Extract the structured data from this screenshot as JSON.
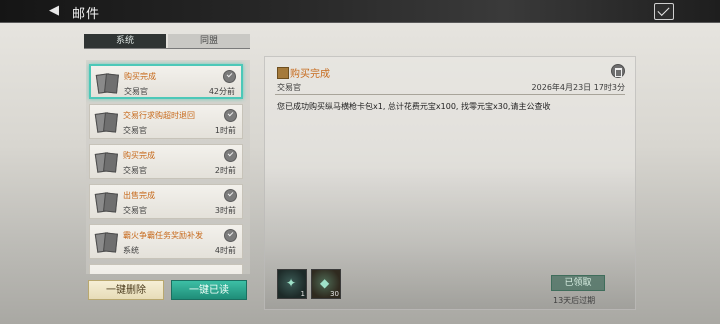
{
  "header": {
    "back_icon": "back-arrow-icon",
    "title": "邮件",
    "mail_icon": "mail-claim-icon"
  },
  "tabs": [
    {
      "label": "系统",
      "active": true
    },
    {
      "label": "同盟",
      "active": false
    }
  ],
  "mail_list": [
    {
      "subject": "购买完成",
      "sender": "交易官",
      "time": "42分前",
      "selected": true
    },
    {
      "subject": "交易行求购超时退回",
      "sender": "交易官",
      "time": "1时前",
      "selected": false
    },
    {
      "subject": "购买完成",
      "sender": "交易官",
      "time": "2时前",
      "selected": false
    },
    {
      "subject": "出售完成",
      "sender": "交易官",
      "time": "3时前",
      "selected": false
    },
    {
      "subject": "霸火争霸任务奖励补发",
      "sender": "系统",
      "time": "4时前",
      "selected": false
    }
  ],
  "actions": {
    "delete_all": "一键删除",
    "read_all": "一键已读"
  },
  "detail": {
    "subject": "购买完成",
    "sender": "交易官",
    "date": "2026年4月23日 17时3分",
    "body": "您已成功购买纵马横枪卡包x1, 总计花费元宝x100, 找零元宝x30,请主公查收",
    "attachments": [
      {
        "icon": "card-pack-icon",
        "qty": "1"
      },
      {
        "icon": "ingot-icon",
        "qty": "30"
      }
    ],
    "claimed_label": "已领取",
    "expire_text": "13天后过期"
  },
  "colors": {
    "accent_teal": "#3dbfa5",
    "subject_orange": "#c76a1c",
    "header_dark": "#1e1e1e"
  }
}
